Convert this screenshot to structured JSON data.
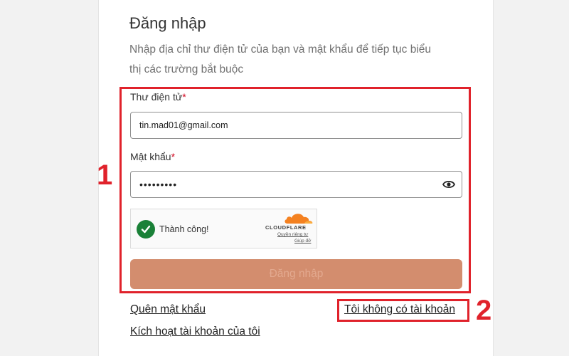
{
  "login": {
    "title": "Đăng nhập",
    "subtitle": "Nhập địa chỉ thư điện tử của bạn và mật khẩu để tiếp tục biểu thị các trường bắt buộc",
    "email": {
      "label": "Thư điện tử",
      "required_mark": "*",
      "value": "tin.mad01@gmail.com"
    },
    "password": {
      "label": "Mật khẩu",
      "required_mark": "*",
      "value": "•••••••••",
      "toggle_icon": "eye-icon"
    },
    "captcha": {
      "status_text": "Thành công!",
      "status_icon": "check-circle-icon",
      "brand": "CLOUDFLARE",
      "privacy_link": "Quyền riêng tư",
      "help_link": "Giúp đỡ"
    },
    "submit_label": "Đăng nhập",
    "forgot_password": "Quên mật khẩu",
    "no_account": "Tôi không có tài khoản",
    "activate_account": "Kích hoạt tài khoản của tôi"
  },
  "annotations": {
    "marker_1": "1",
    "marker_2": "2",
    "color": "#e0222b"
  },
  "colors": {
    "submit_bg": "#d38d6e",
    "check_green": "#1a8138",
    "cloudflare_orange": "#f48120"
  }
}
